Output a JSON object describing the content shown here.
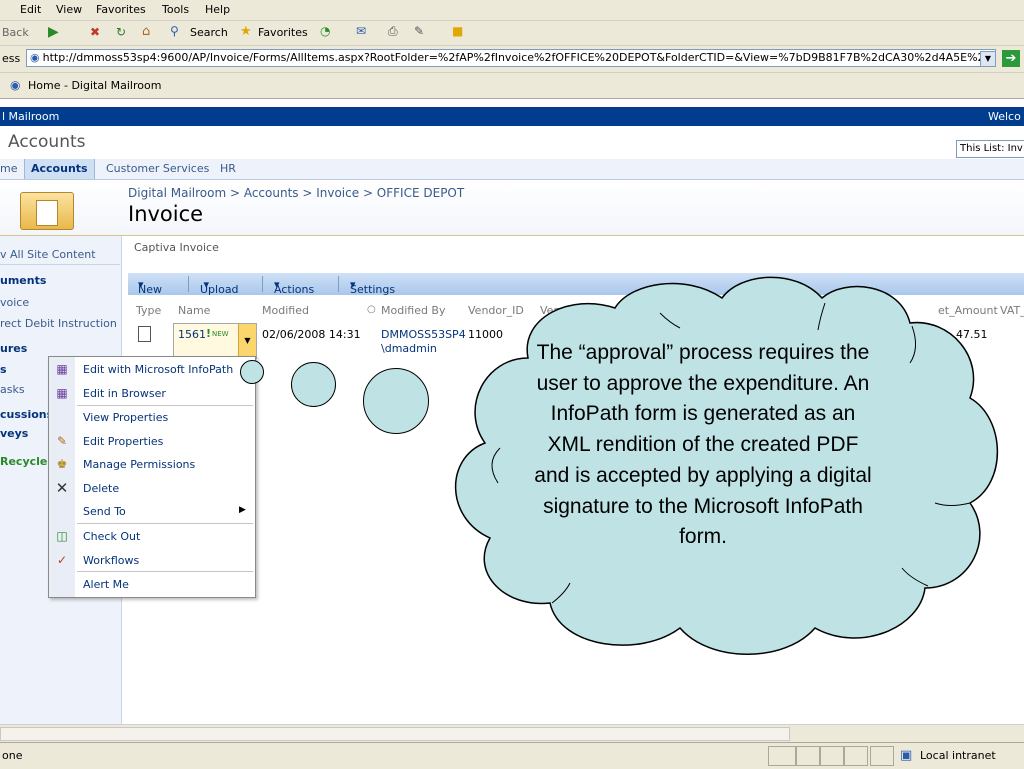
{
  "browser": {
    "menu": [
      "Edit",
      "View",
      "Favorites",
      "Tools",
      "Help"
    ],
    "toolbar": {
      "back": "Back",
      "search": "Search",
      "favorites": "Favorites"
    },
    "address_label": "ess",
    "address_url": "http://dmmoss53sp4:9600/AP/Invoice/Forms/AllItems.aspx?RootFolder=%2fAP%2fInvoice%2fOFFICE%20DEPOT&FolderCTID=&View=%7bD9B81F7B%2dCA30%2d4A5E%2d878",
    "tab_title": "Home - Digital Mailroom",
    "status_text": "one",
    "zone_text": "Local intranet"
  },
  "site": {
    "top_bar_title": "l Mailroom",
    "welcome": "Welco",
    "site_title": "Accounts",
    "search_scope": "This List: Inv",
    "topnav": [
      "me",
      "Accounts",
      "Customer Services",
      "HR"
    ],
    "breadcrumb": "Digital Mailroom > Accounts > Invoice > OFFICE DEPOT",
    "page_title": "Invoice",
    "list_description": "Captiva Invoice"
  },
  "leftnav": {
    "items": [
      "v All Site Content",
      "uments",
      "voice",
      "rect Debit Instruction",
      "ures",
      "s",
      "asks",
      "cussions",
      "veys",
      "Recycle B"
    ]
  },
  "list_toolbar": {
    "new": "New",
    "upload": "Upload",
    "actions": "Actions",
    "settings": "Settings"
  },
  "list": {
    "columns": [
      "Type",
      "Name",
      "Modified",
      "Modified By",
      "Vendor_ID",
      "Vendor_Name",
      "et_Amount",
      "VAT_"
    ],
    "row": {
      "name": "1561",
      "new_badge": "NEW",
      "modified": "02/06/2008 14:31",
      "modified_by_line1": "DMMOSS53SP4",
      "modified_by_line2": "\\dmadmin",
      "vendor_id": "11000",
      "amount": "47.51"
    }
  },
  "context_menu": {
    "items": [
      {
        "label": "Edit with Microsoft InfoPath",
        "icon": "infopath-icon"
      },
      {
        "label": "Edit in Browser",
        "icon": "infopath-icon"
      },
      {
        "label": "View Properties",
        "icon": ""
      },
      {
        "label": "Edit Properties",
        "icon": "edit-properties-icon"
      },
      {
        "label": "Manage Permissions",
        "icon": "permissions-icon"
      },
      {
        "label": "Delete",
        "icon": "delete-icon"
      },
      {
        "label": "Send To",
        "icon": ""
      },
      {
        "label": "Check Out",
        "icon": "checkout-icon"
      },
      {
        "label": "Workflows",
        "icon": "workflows-icon"
      },
      {
        "label": "Alert Me",
        "icon": ""
      }
    ]
  },
  "callout": {
    "text": "The “approval” process requires the user to approve the expenditure.  An InfoPath form is generated as an XML rendition of the created PDF and is accepted by applying a digital signature to the Microsoft InfoPath form.",
    "fill": "#bfe3e5"
  }
}
